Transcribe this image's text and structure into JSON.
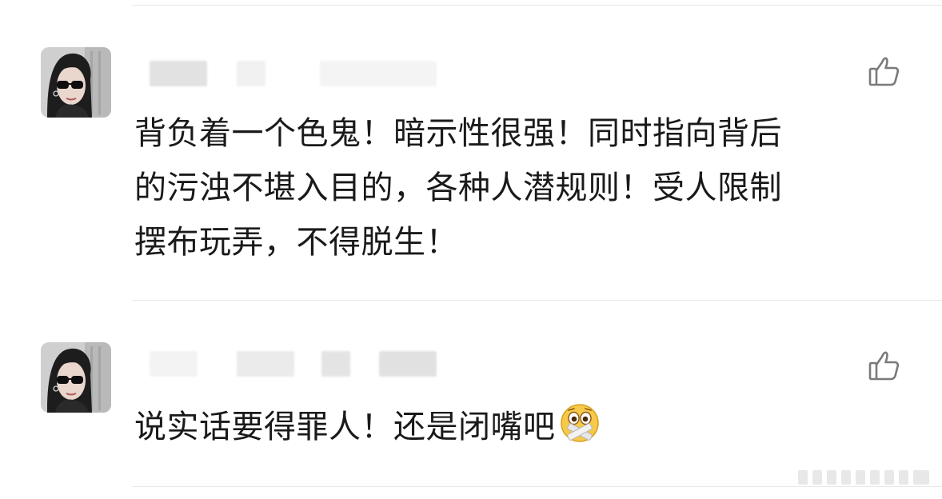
{
  "comments": [
    {
      "text": "背负着一个色鬼！暗示性很强！同时指向背后\n的污浊不堪入目的，各种人潜规则！受人限制\n摆布玩弄，不得脱生！",
      "like_icon": "thumbs-up-icon",
      "avatar_icon": "user-avatar"
    },
    {
      "text": "说实话要得罪人！还是闭嘴吧",
      "emoji": "zipper-mouth-face-icon",
      "like_icon": "thumbs-up-icon",
      "avatar_icon": "user-avatar"
    }
  ],
  "colors": {
    "text": "#1a1a1a",
    "divider": "#e8e8e8",
    "icon": "#7a7a7a",
    "blur": "#e6e6e6",
    "emoji_face": "#f6c94b"
  }
}
